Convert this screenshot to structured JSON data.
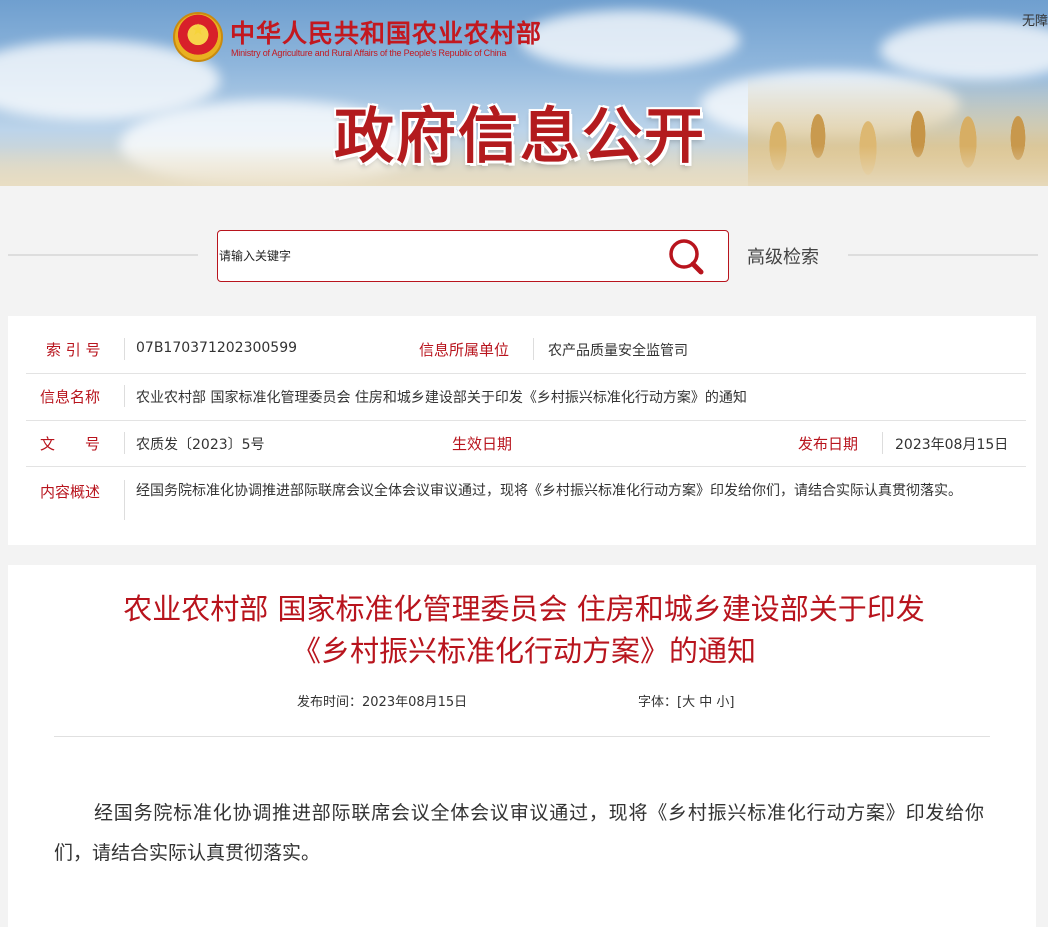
{
  "header": {
    "ministry_cn": "中华人民共和国农业农村部",
    "ministry_en": "Ministry of Agriculture and Rural Affairs of the People's Republic of China",
    "banner_title": "政府信息公开",
    "corner_link": "无障"
  },
  "search": {
    "placeholder": "请输入关键字",
    "advanced_label": "高级检索"
  },
  "info": {
    "index_label": "索 引 号",
    "index_value": "07B170371202300599",
    "unit_label": "信息所属单位",
    "unit_value": "农产品质量安全监管司",
    "name_label": "信息名称",
    "name_value": "农业农村部 国家标准化管理委员会 住房和城乡建设部关于印发《乡村振兴标准化行动方案》的通知",
    "doc_label": "文　　号",
    "doc_value": "农质发〔2023〕5号",
    "effective_label": "生效日期",
    "effective_value": "",
    "publish_label": "发布日期",
    "publish_value": "2023年08月15日",
    "summary_label": "内容概述",
    "summary_value": "经国务院标准化协调推进部际联席会议全体会议审议通过，现将《乡村振兴标准化行动方案》印发给你们，请结合实际认真贯彻落实。"
  },
  "article": {
    "title_line1": "农业农村部 国家标准化管理委员会 住房和城乡建设部关于印发",
    "title_line2": "《乡村振兴标准化行动方案》的通知",
    "publish_time": "发布时间：2023年08月15日",
    "font_prefix": "字体：[",
    "font_large": "大",
    "font_medium": "中",
    "font_small": "小",
    "font_suffix": "]",
    "body": "经国务院标准化协调推进部际联席会议全体会议审议通过，现将《乡村振兴标准化行动方案》印发给你们，请结合实际认真贯彻落实。"
  },
  "colors": {
    "accent": "#b8141d",
    "panel": "#ffffff",
    "page_bg": "#f3f3f3"
  }
}
